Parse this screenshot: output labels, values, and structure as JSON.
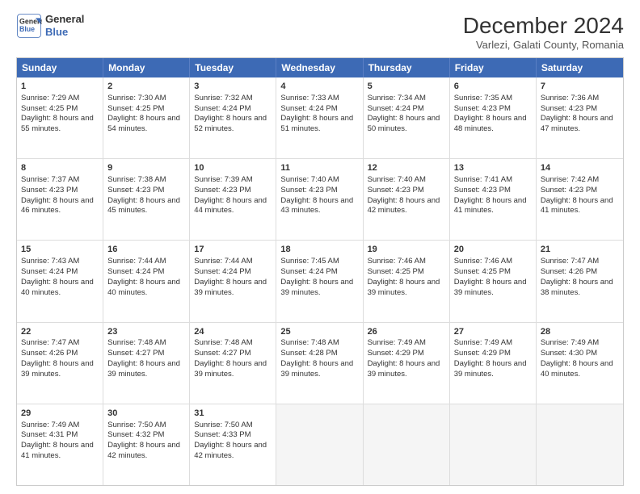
{
  "logo": {
    "line1": "General",
    "line2": "Blue"
  },
  "title": "December 2024",
  "subtitle": "Varlezi, Galati County, Romania",
  "days": [
    "Sunday",
    "Monday",
    "Tuesday",
    "Wednesday",
    "Thursday",
    "Friday",
    "Saturday"
  ],
  "weeks": [
    [
      {
        "day": 1,
        "sunrise": "7:29 AM",
        "sunset": "4:25 PM",
        "daylight": "8 hours and 55 minutes."
      },
      {
        "day": 2,
        "sunrise": "7:30 AM",
        "sunset": "4:25 PM",
        "daylight": "8 hours and 54 minutes."
      },
      {
        "day": 3,
        "sunrise": "7:32 AM",
        "sunset": "4:24 PM",
        "daylight": "8 hours and 52 minutes."
      },
      {
        "day": 4,
        "sunrise": "7:33 AM",
        "sunset": "4:24 PM",
        "daylight": "8 hours and 51 minutes."
      },
      {
        "day": 5,
        "sunrise": "7:34 AM",
        "sunset": "4:24 PM",
        "daylight": "8 hours and 50 minutes."
      },
      {
        "day": 6,
        "sunrise": "7:35 AM",
        "sunset": "4:23 PM",
        "daylight": "8 hours and 48 minutes."
      },
      {
        "day": 7,
        "sunrise": "7:36 AM",
        "sunset": "4:23 PM",
        "daylight": "8 hours and 47 minutes."
      }
    ],
    [
      {
        "day": 8,
        "sunrise": "7:37 AM",
        "sunset": "4:23 PM",
        "daylight": "8 hours and 46 minutes."
      },
      {
        "day": 9,
        "sunrise": "7:38 AM",
        "sunset": "4:23 PM",
        "daylight": "8 hours and 45 minutes."
      },
      {
        "day": 10,
        "sunrise": "7:39 AM",
        "sunset": "4:23 PM",
        "daylight": "8 hours and 44 minutes."
      },
      {
        "day": 11,
        "sunrise": "7:40 AM",
        "sunset": "4:23 PM",
        "daylight": "8 hours and 43 minutes."
      },
      {
        "day": 12,
        "sunrise": "7:40 AM",
        "sunset": "4:23 PM",
        "daylight": "8 hours and 42 minutes."
      },
      {
        "day": 13,
        "sunrise": "7:41 AM",
        "sunset": "4:23 PM",
        "daylight": "8 hours and 41 minutes."
      },
      {
        "day": 14,
        "sunrise": "7:42 AM",
        "sunset": "4:23 PM",
        "daylight": "8 hours and 41 minutes."
      }
    ],
    [
      {
        "day": 15,
        "sunrise": "7:43 AM",
        "sunset": "4:24 PM",
        "daylight": "8 hours and 40 minutes."
      },
      {
        "day": 16,
        "sunrise": "7:44 AM",
        "sunset": "4:24 PM",
        "daylight": "8 hours and 40 minutes."
      },
      {
        "day": 17,
        "sunrise": "7:44 AM",
        "sunset": "4:24 PM",
        "daylight": "8 hours and 39 minutes."
      },
      {
        "day": 18,
        "sunrise": "7:45 AM",
        "sunset": "4:24 PM",
        "daylight": "8 hours and 39 minutes."
      },
      {
        "day": 19,
        "sunrise": "7:46 AM",
        "sunset": "4:25 PM",
        "daylight": "8 hours and 39 minutes."
      },
      {
        "day": 20,
        "sunrise": "7:46 AM",
        "sunset": "4:25 PM",
        "daylight": "8 hours and 39 minutes."
      },
      {
        "day": 21,
        "sunrise": "7:47 AM",
        "sunset": "4:26 PM",
        "daylight": "8 hours and 38 minutes."
      }
    ],
    [
      {
        "day": 22,
        "sunrise": "7:47 AM",
        "sunset": "4:26 PM",
        "daylight": "8 hours and 39 minutes."
      },
      {
        "day": 23,
        "sunrise": "7:48 AM",
        "sunset": "4:27 PM",
        "daylight": "8 hours and 39 minutes."
      },
      {
        "day": 24,
        "sunrise": "7:48 AM",
        "sunset": "4:27 PM",
        "daylight": "8 hours and 39 minutes."
      },
      {
        "day": 25,
        "sunrise": "7:48 AM",
        "sunset": "4:28 PM",
        "daylight": "8 hours and 39 minutes."
      },
      {
        "day": 26,
        "sunrise": "7:49 AM",
        "sunset": "4:29 PM",
        "daylight": "8 hours and 39 minutes."
      },
      {
        "day": 27,
        "sunrise": "7:49 AM",
        "sunset": "4:29 PM",
        "daylight": "8 hours and 39 minutes."
      },
      {
        "day": 28,
        "sunrise": "7:49 AM",
        "sunset": "4:30 PM",
        "daylight": "8 hours and 40 minutes."
      }
    ],
    [
      {
        "day": 29,
        "sunrise": "7:49 AM",
        "sunset": "4:31 PM",
        "daylight": "8 hours and 41 minutes."
      },
      {
        "day": 30,
        "sunrise": "7:50 AM",
        "sunset": "4:32 PM",
        "daylight": "8 hours and 42 minutes."
      },
      {
        "day": 31,
        "sunrise": "7:50 AM",
        "sunset": "4:33 PM",
        "daylight": "8 hours and 42 minutes."
      },
      null,
      null,
      null,
      null
    ]
  ]
}
